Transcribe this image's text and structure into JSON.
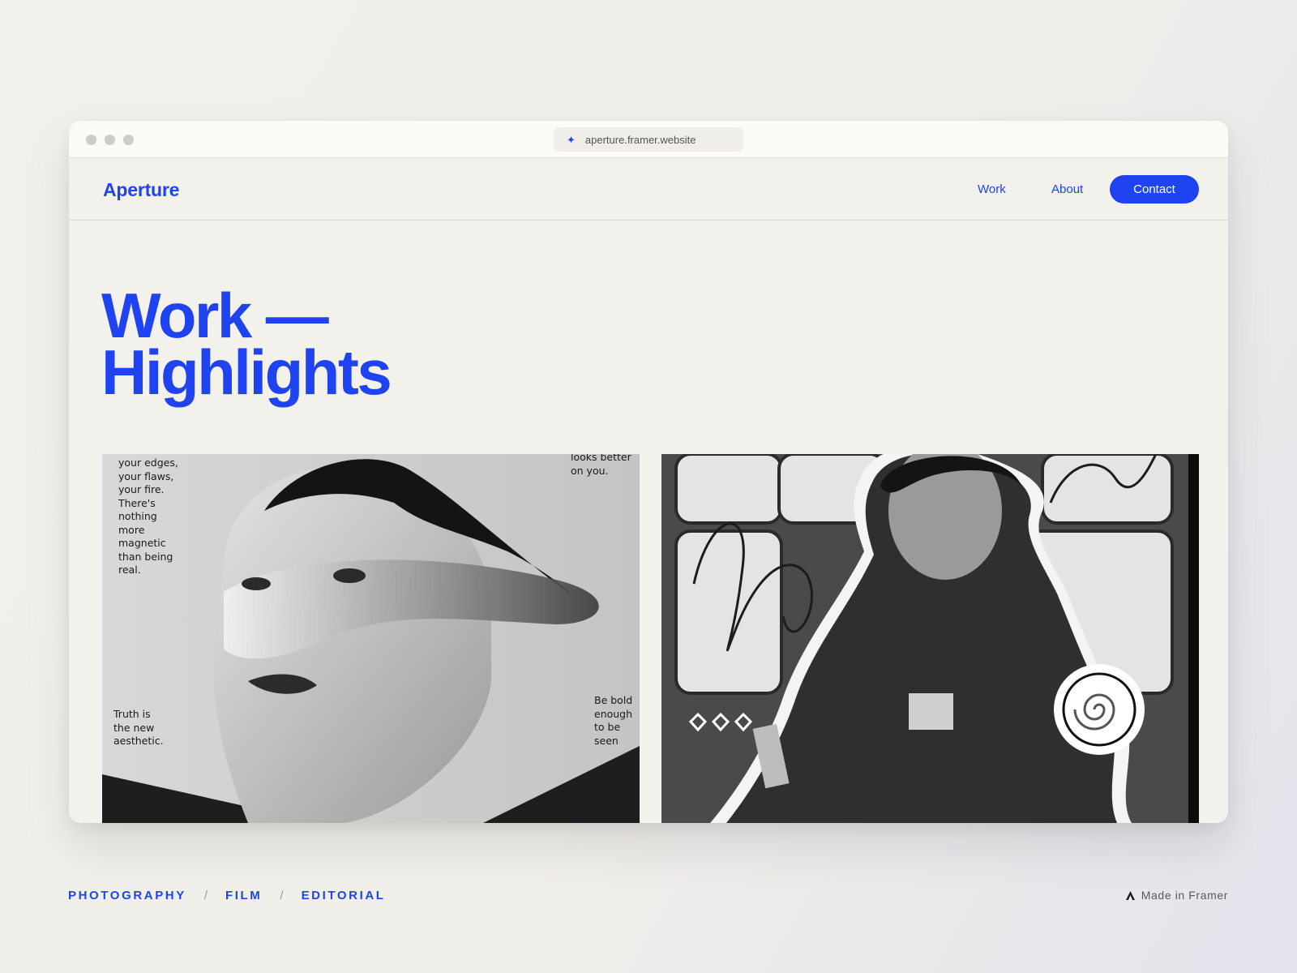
{
  "browser": {
    "url": "aperture.framer.website"
  },
  "nav": {
    "logo": "Aperture",
    "links": [
      "Work",
      "About"
    ],
    "cta": "Contact"
  },
  "hero": {
    "title_line1": "Work —",
    "title_line2": "Highlights"
  },
  "cards": [
    {
      "top_left_text": "your edges,\nyour flaws,\nyour fire.\nThere's\nnothing\nmore\nmagnetic\nthan being\nreal.",
      "top_right_text": "looks better\non you.",
      "bottom_left_text": "Truth is\nthe new\naesthetic.",
      "bottom_right_text": "Be bold\nenough\nto be\nseen"
    },
    {}
  ],
  "footer": {
    "categories": [
      "PHOTOGRAPHY",
      "FILM",
      "EDITORIAL"
    ],
    "separator": "/",
    "made_in": "Made in Framer"
  },
  "colors": {
    "accent": "#1f43f0",
    "background": "#f2f1ec"
  }
}
